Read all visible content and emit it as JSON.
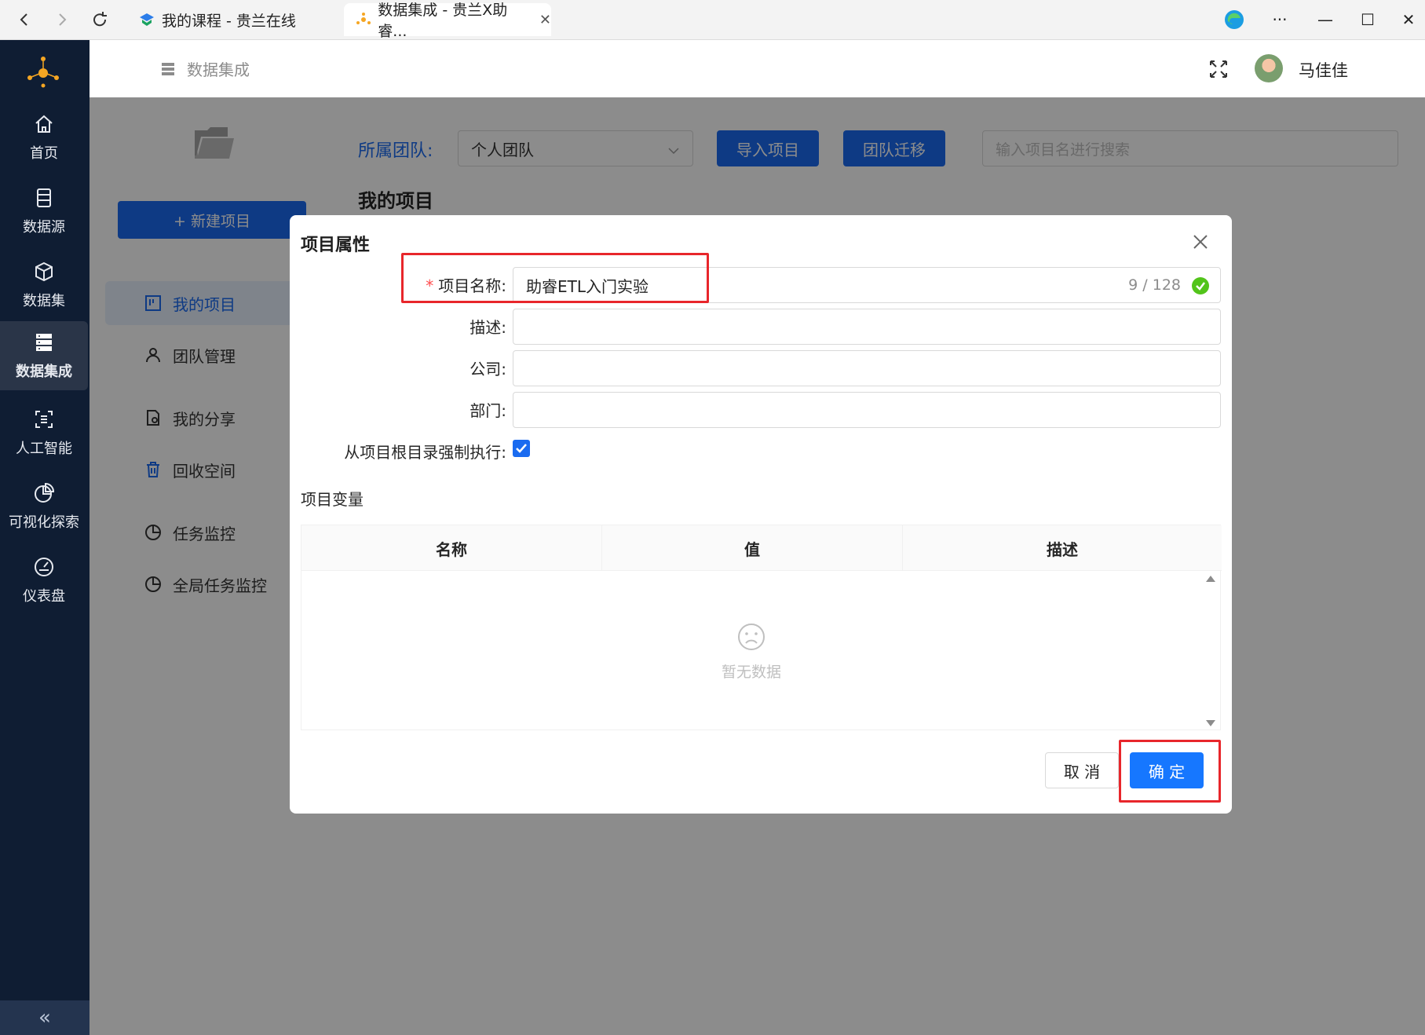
{
  "browser": {
    "tabs": [
      {
        "title": "我的课程 - 贵兰在线",
        "active": false
      },
      {
        "title": "数据集成 - 贵兰X助睿...",
        "active": true
      }
    ],
    "window_controls": {
      "more": "···",
      "minimize": "—",
      "maximize": "☐",
      "close": "✕"
    }
  },
  "rail": {
    "items": [
      {
        "label": "首页",
        "icon": "home-icon"
      },
      {
        "label": "数据源",
        "icon": "database-icon"
      },
      {
        "label": "数据集",
        "icon": "cube-icon"
      },
      {
        "label": "数据集成",
        "icon": "server-icon",
        "active": true
      },
      {
        "label": "人工智能",
        "icon": "ai-icon"
      },
      {
        "label": "可视化探索",
        "icon": "pie-chart-icon"
      },
      {
        "label": "仪表盘",
        "icon": "dashboard-icon"
      }
    ],
    "collapse": "«"
  },
  "header": {
    "breadcrumb": "数据集成",
    "username": "马佳佳"
  },
  "sidebar": {
    "new_project": "+ 新建项目",
    "items": [
      {
        "label": "我的项目",
        "active": true
      },
      {
        "label": "团队管理"
      },
      {
        "label": "我的分享"
      },
      {
        "label": "回收空间"
      },
      {
        "label": "任务监控"
      },
      {
        "label": "全局任务监控"
      }
    ]
  },
  "main": {
    "team_label": "所属团队:",
    "team_value": "个人团队",
    "import_btn": "导入项目",
    "migrate_btn": "团队迁移",
    "search_placeholder": "输入项目名进行搜索",
    "heading": "我的项目"
  },
  "modal": {
    "title": "项目属性",
    "fields": {
      "name_label": "项目名称:",
      "name_value": "助睿ETL入门实验",
      "name_counter": "9 / 128",
      "desc_label": "描述:",
      "company_label": "公司:",
      "dept_label": "部门:",
      "force_label": "从项目根目录强制执行:",
      "force_checked": true
    },
    "variables_title": "项目变量",
    "table_headers": [
      "名称",
      "值",
      "描述"
    ],
    "empty_text": "暂无数据",
    "cancel": "取 消",
    "ok": "确 定"
  },
  "colors": {
    "accent": "#1a6bf0",
    "rail_bg": "#0f1d33",
    "highlight": "#e8262b",
    "success": "#52c41a"
  }
}
